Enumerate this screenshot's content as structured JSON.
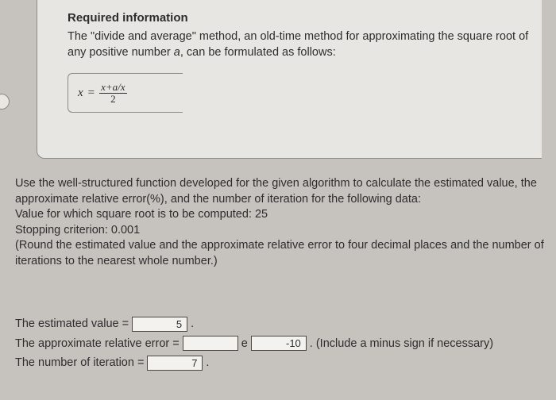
{
  "info": {
    "title": "Required information",
    "desc_pre": "The \"divide and average\" method, an old-time method for approximating the square root of any positive number ",
    "desc_var": "a",
    "desc_post": ", can be formulated as follows:",
    "formula": {
      "lhs": "x",
      "eq": "=",
      "num": "x+a/x",
      "den": "2"
    }
  },
  "body": {
    "p1": "Use the well-structured function developed for the given algorithm to calculate the estimated value, the approximate relative error(%), and the number of iteration for the following data:",
    "p2": "Value for which square root is to be computed: 25",
    "p3": "Stopping criterion: 0.001",
    "p4": "(Round the estimated value and the approximate relative error to four decimal places and the number of iterations to the nearest whole number.)"
  },
  "answers": {
    "est_label": "The estimated value =",
    "est_value": "5",
    "are_label": "The approximate relative error =",
    "are_mantissa": "",
    "e": "e",
    "are_exponent": "-10",
    "are_tail": ". (Include a minus sign if necessary)",
    "iter_label": "The number of iteration =",
    "iter_value": "7",
    "dot": "."
  }
}
